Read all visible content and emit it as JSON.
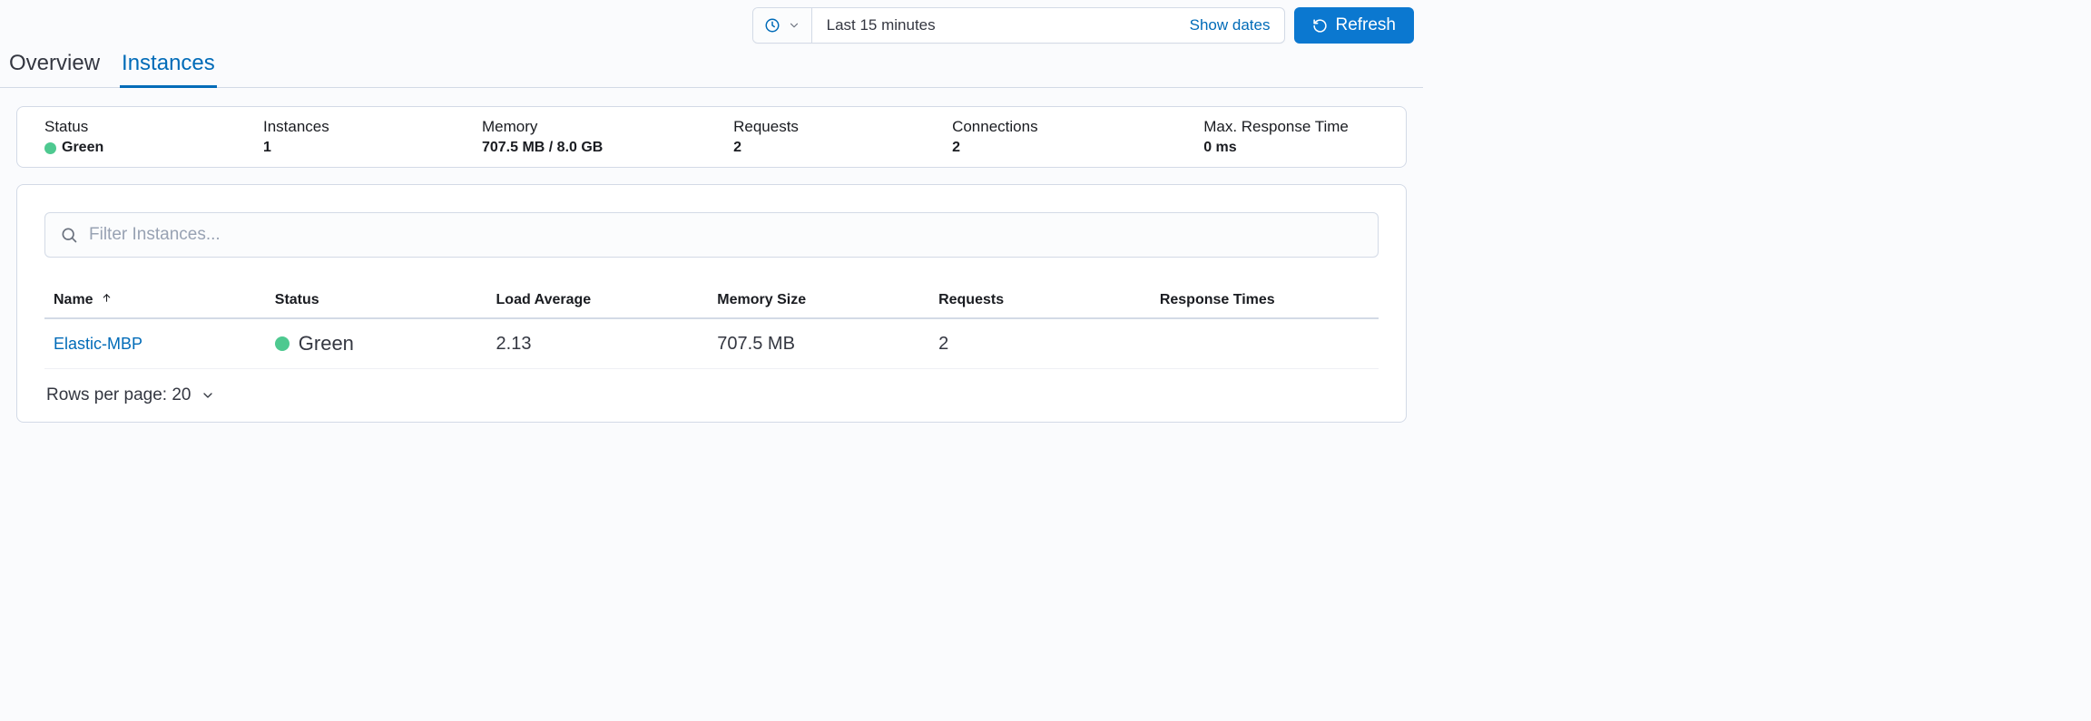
{
  "toolbar": {
    "time_range": "Last 15 minutes",
    "show_dates_label": "Show dates",
    "refresh_label": "Refresh"
  },
  "tabs": {
    "overview": "Overview",
    "instances": "Instances"
  },
  "stats": {
    "status": {
      "label": "Status",
      "value": "Green"
    },
    "instances": {
      "label": "Instances",
      "value": "1"
    },
    "memory": {
      "label": "Memory",
      "value": "707.5 MB / 8.0 GB"
    },
    "requests": {
      "label": "Requests",
      "value": "2"
    },
    "connections": {
      "label": "Connections",
      "value": "2"
    },
    "max_response": {
      "label": "Max. Response Time",
      "value": "0 ms"
    }
  },
  "filter": {
    "placeholder": "Filter Instances..."
  },
  "table": {
    "headers": {
      "name": "Name",
      "status": "Status",
      "load": "Load Average",
      "memory": "Memory Size",
      "requests": "Requests",
      "response": "Response Times"
    },
    "rows": [
      {
        "name": "Elastic-MBP",
        "status": "Green",
        "load": "2.13",
        "memory": "707.5 MB",
        "requests": "2",
        "response": ""
      }
    ]
  },
  "pagination": {
    "rows_label": "Rows per page: 20"
  }
}
